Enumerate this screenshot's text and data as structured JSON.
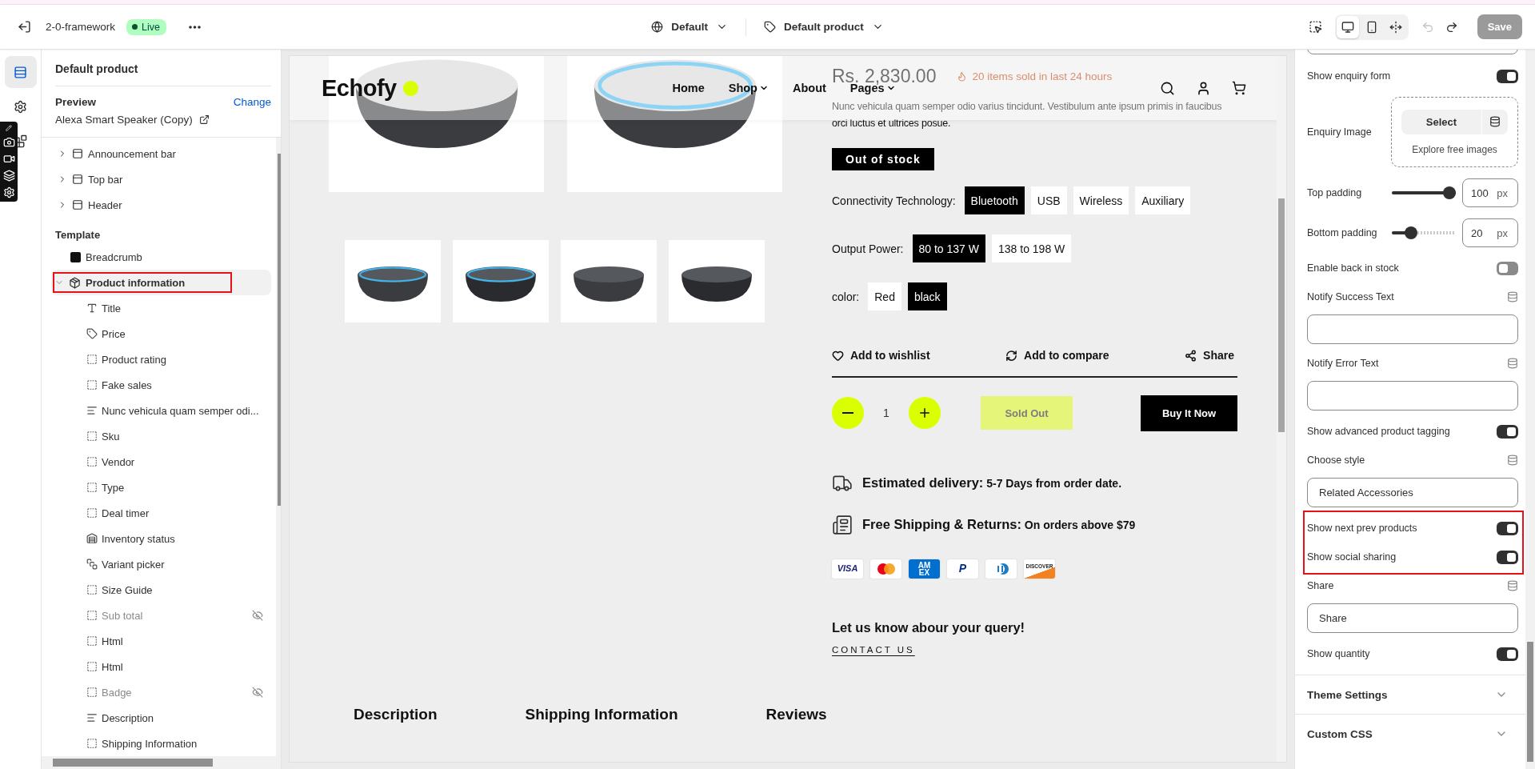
{
  "topbar": {
    "theme_name": "2-0-framework",
    "status": "Live",
    "locale": "Default",
    "template": "Default product",
    "view_modes": [
      {
        "kind": "desktop",
        "selected": true
      },
      {
        "kind": "mobile",
        "selected": false
      },
      {
        "kind": "fullwidth",
        "selected": false
      }
    ],
    "undo": {
      "disabled": true
    },
    "redo": {
      "disabled": false
    },
    "save": {
      "label": "Save",
      "disabled": true
    }
  },
  "rail": [
    {
      "kind": "sections",
      "selected": true
    },
    {
      "kind": "settings",
      "selected": false
    },
    {
      "kind": "apps",
      "selected": false
    }
  ],
  "sidebar": {
    "title": "Default product",
    "preview_label": "Preview",
    "change": "Change",
    "preview_product": "Alexa Smart Speaker (Copy)",
    "header_sections": [
      {
        "label": "Announcement bar",
        "expanded": false
      },
      {
        "label": "Top bar",
        "expanded": false
      },
      {
        "label": "Header",
        "expanded": false
      }
    ],
    "template_label": "Template",
    "template_sections": [
      {
        "label": "Breadcrumb",
        "kind": "breadcrumb",
        "selected": false,
        "highlighted": false
      },
      {
        "label": "Product information",
        "kind": "product",
        "expanded": true,
        "selected": true,
        "highlighted": true,
        "children": [
          {
            "label": "Title",
            "kind": "text",
            "hidden": false
          },
          {
            "label": "Price",
            "kind": "price",
            "hidden": false
          },
          {
            "label": "Product rating",
            "kind": "block",
            "hidden": false
          },
          {
            "label": "Fake sales",
            "kind": "block",
            "hidden": false
          },
          {
            "label": "Nunc vehicula quam semper odi...",
            "kind": "lines",
            "hidden": false
          },
          {
            "label": "Sku",
            "kind": "block",
            "hidden": false
          },
          {
            "label": "Vendor",
            "kind": "block",
            "hidden": false
          },
          {
            "label": "Type",
            "kind": "block",
            "hidden": false
          },
          {
            "label": "Deal timer",
            "kind": "block",
            "hidden": false
          },
          {
            "label": "Inventory status",
            "kind": "inventory",
            "hidden": false
          },
          {
            "label": "Variant picker",
            "kind": "variant",
            "hidden": false
          },
          {
            "label": "Size Guide",
            "kind": "block",
            "hidden": false
          },
          {
            "label": "Sub total",
            "kind": "block",
            "hidden": true
          },
          {
            "label": "Html",
            "kind": "block",
            "hidden": false
          },
          {
            "label": "Html",
            "kind": "block",
            "hidden": false
          },
          {
            "label": "Badge",
            "kind": "block",
            "hidden": true
          },
          {
            "label": "Description",
            "kind": "lines",
            "hidden": false
          },
          {
            "label": "Shipping Information",
            "kind": "block",
            "hidden": false
          }
        ]
      }
    ]
  },
  "preview": {
    "logo": "Echofy",
    "nav": [
      {
        "label": "Home",
        "dropdown": false
      },
      {
        "label": "Shop",
        "dropdown": true
      },
      {
        "label": "About",
        "dropdown": false
      },
      {
        "label": "Pages",
        "dropdown": true
      }
    ],
    "price": "Rs. 2,830.00",
    "sold": "20 items sold in last 24 hours",
    "description": "Nunc vehicula quam semper odio varius tincidunt. Vestibulum ante ipsum primis in faucibus orci luctus et ultrices posue.",
    "stock_badge": "Out of stock",
    "options": [
      {
        "label": "Connectivity Technology:",
        "values": [
          {
            "label": "Bluetooth",
            "selected": true
          },
          {
            "label": "USB",
            "selected": false
          },
          {
            "label": "Wireless",
            "selected": false
          },
          {
            "label": "Auxiliary",
            "selected": false
          }
        ]
      },
      {
        "label": "Output Power:",
        "values": [
          {
            "label": "80 to 137 W",
            "selected": true
          },
          {
            "label": "138 to 198 W",
            "selected": false
          }
        ]
      },
      {
        "label": "color:",
        "values": [
          {
            "label": "Red",
            "selected": false
          },
          {
            "label": "black",
            "selected": true
          }
        ]
      }
    ],
    "actions": [
      {
        "kind": "wishlist",
        "label": "Add to wishlist"
      },
      {
        "kind": "compare",
        "label": "Add to compare"
      },
      {
        "kind": "share",
        "label": "Share"
      }
    ],
    "quantity": "1",
    "sold_out": "Sold Out",
    "buy_now": "Buy It Now",
    "info": [
      {
        "kind": "delivery",
        "title": "Estimated delivery:",
        "text": "5-7 Days from order date."
      },
      {
        "kind": "shipping",
        "title": "Free Shipping & Returns:",
        "text": "On orders above $79"
      }
    ],
    "payments": [
      {
        "kind": "visa",
        "label": "VISA"
      },
      {
        "kind": "mastercard"
      },
      {
        "kind": "amex",
        "label": "AM EX"
      },
      {
        "kind": "paypal",
        "label": "P"
      },
      {
        "kind": "diners"
      },
      {
        "kind": "discover",
        "label": "DISCOVER"
      }
    ],
    "query": "Let us know abour your query!",
    "contact": "CONTACT US",
    "tabs": [
      "Description",
      "Shipping Information",
      "Reviews"
    ]
  },
  "settings": [
    {
      "kind": "toggle",
      "label": "Show enquiry form",
      "on": true,
      "highlighted": false
    },
    {
      "kind": "image",
      "label": "Enquiry Image",
      "button": "Select",
      "link": "Explore free images"
    },
    {
      "kind": "range",
      "label": "Top padding",
      "level": 1,
      "value": "100",
      "unit": "px"
    },
    {
      "kind": "range",
      "label": "Bottom padding",
      "level": 0.25,
      "value": "20",
      "unit": "px"
    },
    {
      "kind": "toggle",
      "label": "Enable back in stock",
      "on": false,
      "highlighted": false
    },
    {
      "kind": "text",
      "label": "Notify Success Text"
    },
    {
      "kind": "text",
      "label": "Notify Error Text"
    },
    {
      "kind": "toggle",
      "label": "Show advanced product tagging",
      "on": true,
      "highlighted": false
    },
    {
      "kind": "text",
      "label": "Choose style",
      "value": "Related Accessories"
    },
    {
      "kind": "toggle",
      "label": "Show next prev products",
      "on": true,
      "highlighted": true
    },
    {
      "kind": "toggle",
      "label": "Show social sharing",
      "on": true,
      "highlighted": true
    },
    {
      "kind": "text",
      "label": "Share",
      "value": "Share"
    },
    {
      "kind": "toggle",
      "label": "Show quantity",
      "on": true,
      "highlighted": false
    }
  ],
  "accordions": [
    {
      "label": "Theme Settings",
      "expanded": false
    },
    {
      "label": "Custom CSS",
      "expanded": false
    }
  ]
}
